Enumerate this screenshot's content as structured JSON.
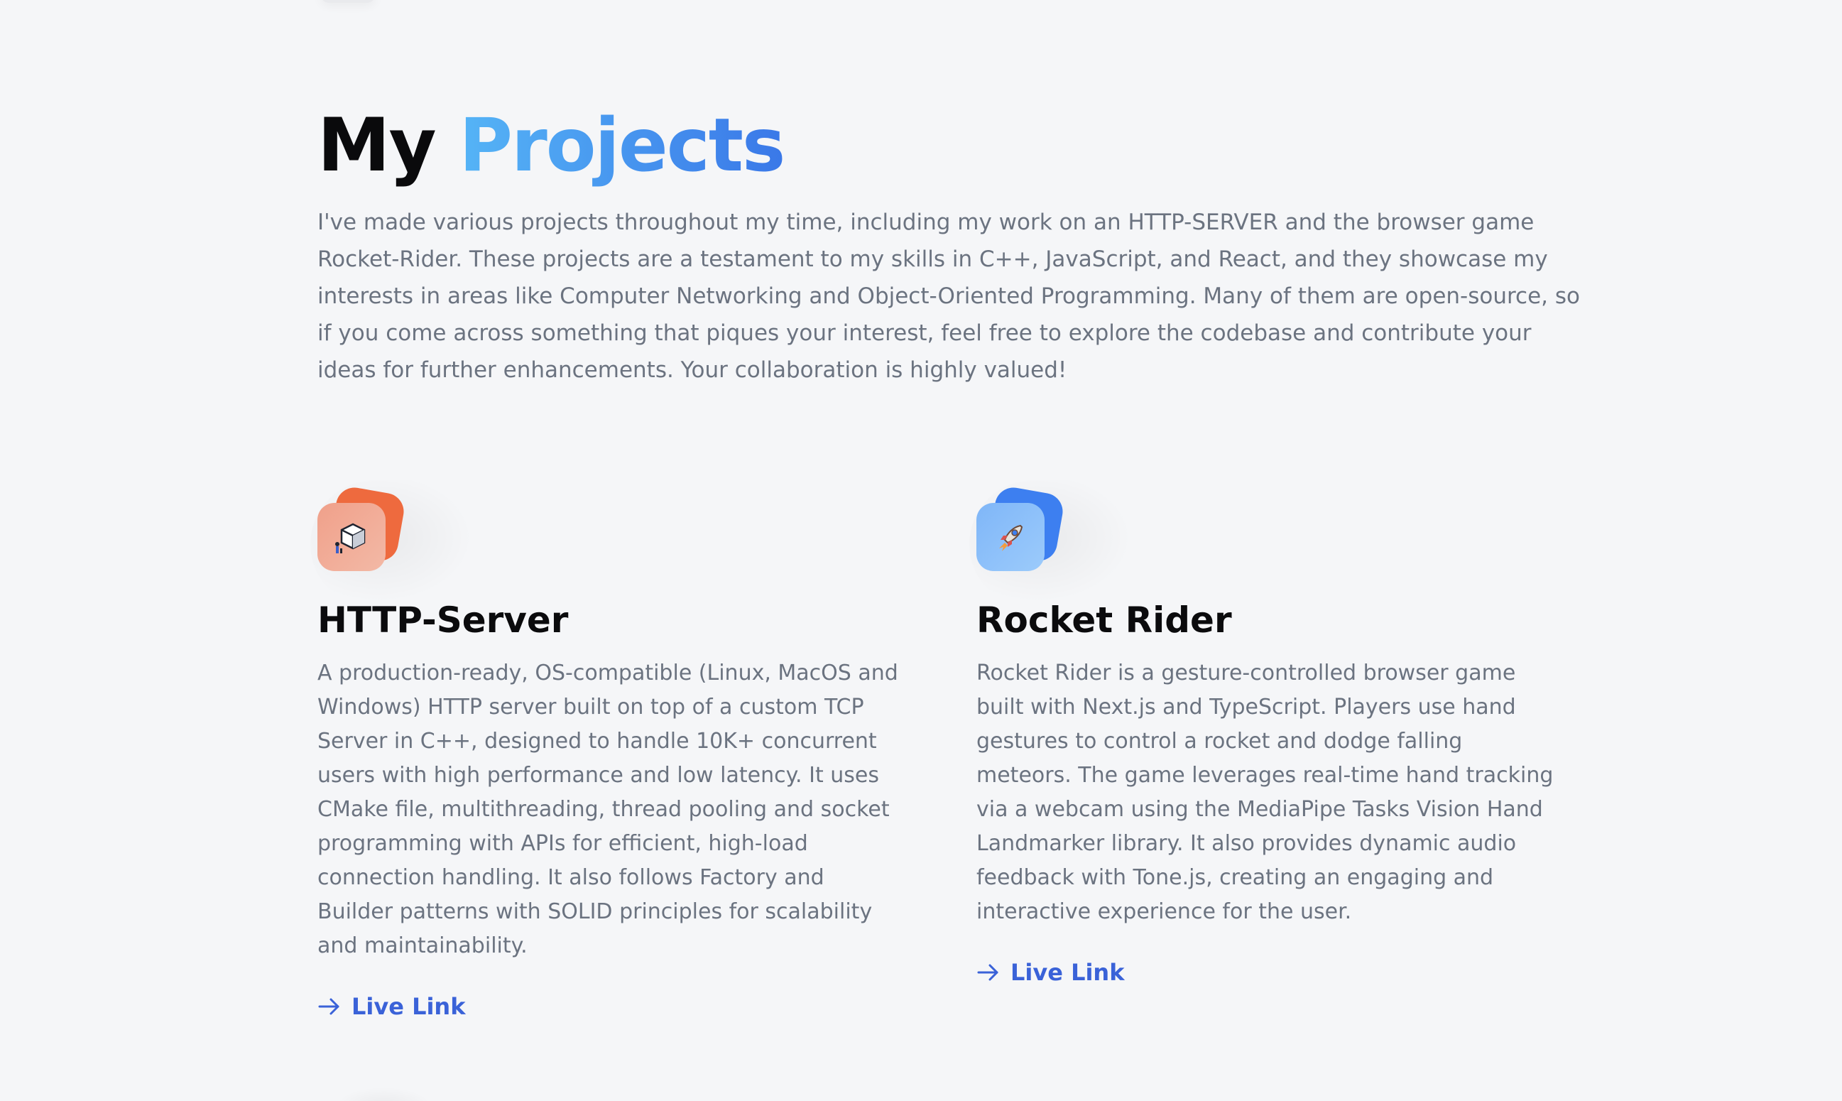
{
  "projects_section": {
    "heading_plain": "My",
    "heading_accent": "Projects",
    "intro": "I've made various projects throughout my time, including my work on an HTTP-SERVER and the browser game Rocket-Rider. These projects are a testament to my skills in C++, JavaScript, and React, and they showcase my interests in areas like Computer Networking and Object-Oriented Programming. Many of them are open-source, so if you come across something that piques your interest, feel free to explore the codebase and contribute your ideas for further enhancements. Your collaboration is highly valued!",
    "projects": [
      {
        "title": "HTTP-Server",
        "icon": "server-cube-icon",
        "accent_color": "#ee6a3e",
        "description": "A production-ready, OS-compatible (Linux, MacOS and Windows) HTTP server built on top of a custom TCP Server in C++, designed to handle 10K+ concurrent users with high performance and low latency. It uses CMake file, multithreading, thread pooling and socket programming with APIs for efficient, high-load connection handling. It also follows Factory and Builder patterns with SOLID principles for scalability and maintainability.",
        "link_label": "Live Link"
      },
      {
        "title": "Rocket Rider",
        "icon": "rocket-icon",
        "accent_color": "#3d7ff0",
        "description": "Rocket Rider is a gesture-controlled browser game built with Next.js and TypeScript. Players use hand gestures to control a rocket and dodge falling meteors. The game leverages real-time hand tracking via a webcam using the MediaPipe Tasks Vision Hand Landmarker library. It also provides dynamic audio feedback with Tone.js, creating an engaging and interactive experience for the user.",
        "link_label": "Live Link"
      }
    ],
    "link_color": "#3a62d8",
    "heading_gradient": [
      "#55b4f6",
      "#3a78e8"
    ]
  }
}
